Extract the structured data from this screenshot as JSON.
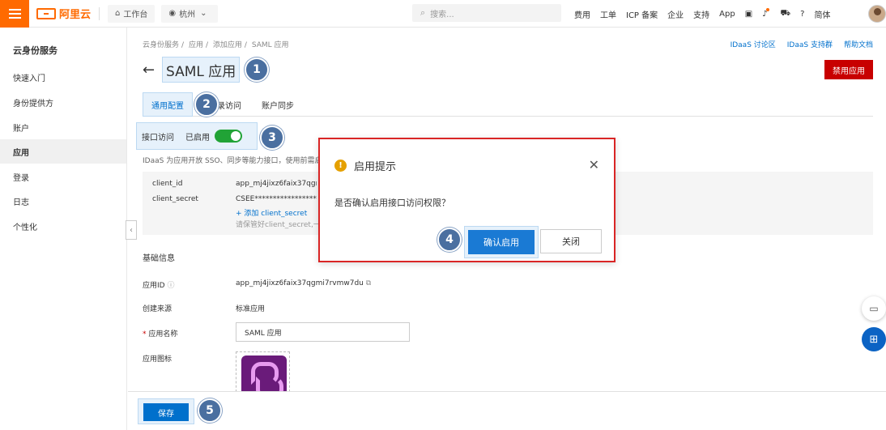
{
  "topbar": {
    "brand": "阿里云",
    "workbench": "工作台",
    "region": "杭州",
    "search_placeholder": "搜索...",
    "links": [
      "费用",
      "工单",
      "ICP 备案",
      "企业",
      "支持",
      "App"
    ],
    "lang": "简体"
  },
  "sidebar": {
    "title": "云身份服务",
    "items": [
      {
        "label": "快速入门"
      },
      {
        "label": "身份提供方"
      },
      {
        "label": "账户"
      },
      {
        "label": "应用"
      },
      {
        "label": "登录"
      },
      {
        "label": "日志"
      },
      {
        "label": "个性化"
      }
    ],
    "active": "应用"
  },
  "breadcrumb": [
    "云身份服务",
    "应用",
    "添加应用",
    "SAML 应用"
  ],
  "toplinks": [
    "IDaaS 讨论区",
    "IDaaS 支持群",
    "帮助文档"
  ],
  "page": {
    "title": "SAML 应用",
    "disable_button": "禁用应用"
  },
  "tabs": [
    {
      "label": "通用配置"
    },
    {
      "label": "录访问"
    },
    {
      "label": "账户同步"
    }
  ],
  "interface_access": {
    "label": "接口访问",
    "status": "已启用",
    "enabled": true
  },
  "description": "IDaaS 为应用开放 SSO、同步等能力接口，使用前需启",
  "credentials": {
    "client_id_label": "client_id",
    "client_id_value": "app_mj4jixz6faix37qgmi7",
    "client_secret_label": "client_secret",
    "client_secret_value": "CSEE************************",
    "add_secret": "添加 client_secret",
    "hint": "请保管好client_secret,一旦"
  },
  "basic_info": {
    "section_title": "基础信息",
    "app_id_label": "应用ID",
    "app_id_value": "app_mj4jixz6faix37qgmi7rvmw7du",
    "source_label": "创建来源",
    "source_value": "标准应用",
    "name_label": "应用名称",
    "name_value": "SAML 应用",
    "icon_label": "应用图标"
  },
  "footer": {
    "save_label": "保存"
  },
  "modal": {
    "title": "启用提示",
    "message": "是否确认启用接口访问权限？",
    "confirm_label": "确认启用",
    "cancel_label": "关闭"
  },
  "badges": [
    "1",
    "2",
    "3",
    "4",
    "5"
  ],
  "colors": {
    "accent": "#0070cc",
    "brand": "#ff6a00",
    "danger": "#c80000",
    "toggle_on": "#21a336"
  }
}
